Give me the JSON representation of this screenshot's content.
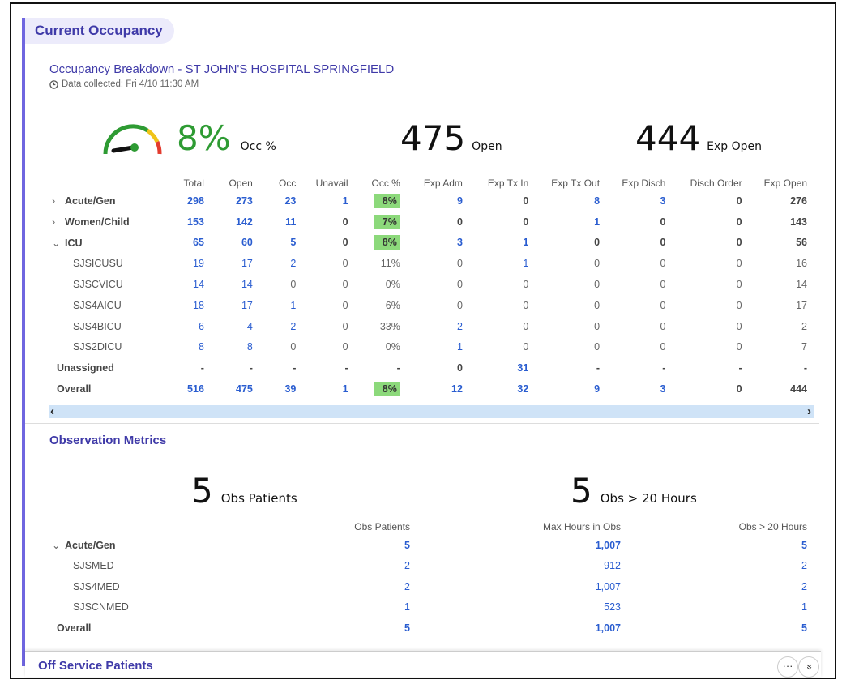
{
  "section_title": "Current Occupancy",
  "breakdown_title": "Occupancy Breakdown - ST JOHN'S HOSPITAL SPRINGFIELD",
  "collected": "Data collected: Fri 4/10 11:30 AM",
  "gauge": {
    "value_fraction": 0.08,
    "colors": {
      "green": "#2e9b33",
      "yellow": "#f0c419",
      "red": "#e33b2e"
    }
  },
  "kpis": {
    "occ_value": "8%",
    "occ_label": "Occ %",
    "open_value": "475",
    "open_label": "Open",
    "exp_value": "444",
    "exp_label": "Exp Open"
  },
  "occ_headers": [
    "",
    "Total",
    "Open",
    "Occ",
    "Unavail",
    "Occ %",
    "Exp Adm",
    "Exp Tx In",
    "Exp Tx Out",
    "Exp Disch",
    "Disch Order",
    "Exp Open"
  ],
  "occ_rows": [
    {
      "kind": "grp",
      "chev": ">",
      "label": "Acute/Gen",
      "cells": [
        "298",
        "273",
        "23",
        "1",
        "8%",
        "9",
        "0",
        "8",
        "3",
        "0",
        "276"
      ],
      "links": [
        0,
        1,
        2,
        3,
        5,
        7,
        8
      ],
      "hl": 4
    },
    {
      "kind": "grp",
      "chev": ">",
      "label": "Women/Child",
      "cells": [
        "153",
        "142",
        "11",
        "0",
        "7%",
        "0",
        "0",
        "1",
        "0",
        "0",
        "143"
      ],
      "links": [
        0,
        1,
        2,
        7
      ],
      "hl": 4
    },
    {
      "kind": "grp",
      "chev": "v",
      "label": "ICU",
      "cells": [
        "65",
        "60",
        "5",
        "0",
        "8%",
        "3",
        "1",
        "0",
        "0",
        "0",
        "56"
      ],
      "links": [
        0,
        1,
        2,
        5,
        6
      ],
      "hl": 4
    },
    {
      "kind": "sub",
      "label": "SJSICUSU",
      "cells": [
        "19",
        "17",
        "2",
        "0",
        "11%",
        "0",
        "1",
        "0",
        "0",
        "0",
        "16"
      ],
      "links": [
        0,
        1,
        2,
        6
      ]
    },
    {
      "kind": "sub",
      "label": "SJSCVICU",
      "cells": [
        "14",
        "14",
        "0",
        "0",
        "0%",
        "0",
        "0",
        "0",
        "0",
        "0",
        "14"
      ],
      "links": [
        0,
        1
      ]
    },
    {
      "kind": "sub",
      "label": "SJS4AICU",
      "cells": [
        "18",
        "17",
        "1",
        "0",
        "6%",
        "0",
        "0",
        "0",
        "0",
        "0",
        "17"
      ],
      "links": [
        0,
        1,
        2
      ]
    },
    {
      "kind": "sub",
      "label": "SJS4BICU",
      "cells": [
        "6",
        "4",
        "2",
        "0",
        "33%",
        "2",
        "0",
        "0",
        "0",
        "0",
        "2"
      ],
      "links": [
        0,
        1,
        2,
        5
      ]
    },
    {
      "kind": "sub",
      "label": "SJS2DICU",
      "cells": [
        "8",
        "8",
        "0",
        "0",
        "0%",
        "1",
        "0",
        "0",
        "0",
        "0",
        "7"
      ],
      "links": [
        0,
        1,
        5
      ]
    },
    {
      "kind": "grp",
      "label": "Unassigned",
      "cells": [
        "-",
        "-",
        "-",
        "-",
        "-",
        "0",
        "31",
        "-",
        "-",
        "-",
        "-"
      ],
      "links": [
        6
      ]
    },
    {
      "kind": "grp",
      "label": "Overall",
      "cells": [
        "516",
        "475",
        "39",
        "1",
        "8%",
        "12",
        "32",
        "9",
        "3",
        "0",
        "444"
      ],
      "links": [
        0,
        1,
        2,
        3,
        5,
        6,
        7,
        8
      ],
      "hl": 4
    }
  ],
  "obs_title": "Observation Metrics",
  "obs_kpis": {
    "patients_value": "5",
    "patients_label": "Obs Patients",
    "over_value": "5",
    "over_label": "Obs > 20 Hours"
  },
  "obs_headers": [
    "",
    "Obs Patients",
    "Max Hours in Obs",
    "Obs > 20 Hours"
  ],
  "obs_rows": [
    {
      "kind": "grp",
      "chev": "v",
      "label": "Acute/Gen",
      "cells": [
        "5",
        "1,007",
        "5"
      ]
    },
    {
      "kind": "sub",
      "label": "SJSMED",
      "cells": [
        "2",
        "912",
        "2"
      ]
    },
    {
      "kind": "sub",
      "label": "SJS4MED",
      "cells": [
        "2",
        "1,007",
        "2"
      ]
    },
    {
      "kind": "sub",
      "label": "SJSCNMED",
      "cells": [
        "1",
        "523",
        "1"
      ]
    },
    {
      "kind": "grp",
      "label": "Overall",
      "cells": [
        "5",
        "1,007",
        "5"
      ]
    }
  ],
  "off_service_title": "Off Service Patients",
  "more_glyph": "···",
  "collapse_glyph": "»"
}
